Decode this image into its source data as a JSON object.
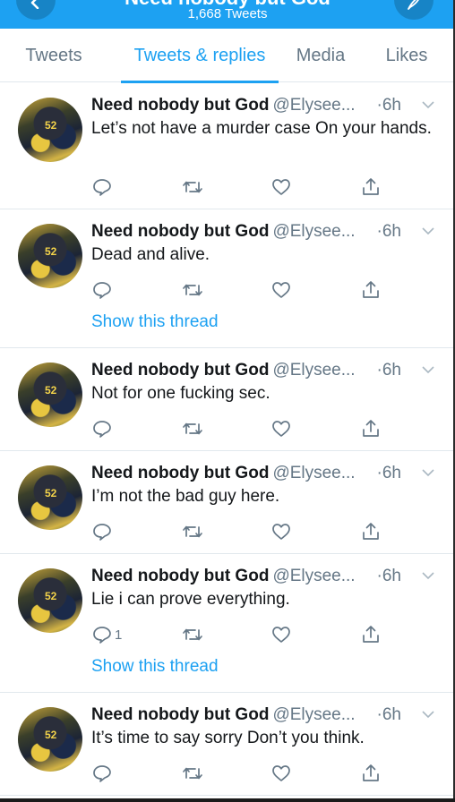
{
  "header": {
    "profile_name": "Need nobody but God",
    "tweet_count": "1,668 Tweets",
    "back_icon": "chevron-left-icon",
    "compose_icon": "feather-icon",
    "color": "#1da1f2"
  },
  "tabs": [
    {
      "label": "Tweets",
      "active": false
    },
    {
      "label": "Tweets & replies",
      "active": true
    },
    {
      "label": "Media",
      "active": false
    },
    {
      "label": "Likes",
      "active": false
    }
  ],
  "tweets": [
    {
      "name": "Need nobody but God",
      "handle": "@Elysee...",
      "time": "·6h",
      "text": "Let’s not have a murder case On your hands.",
      "reply_count": "",
      "thread_link": ""
    },
    {
      "name": "Need nobody but God",
      "handle": "@Elysee...",
      "time": "·6h",
      "text": "Dead and alive.",
      "reply_count": "",
      "thread_link": "Show this thread"
    },
    {
      "name": "Need nobody but God",
      "handle": "@Elysee...",
      "time": "·6h",
      "text": "Not for one fucking sec.",
      "reply_count": "",
      "thread_link": ""
    },
    {
      "name": "Need nobody but God",
      "handle": "@Elysee...",
      "time": "·6h",
      "text": "I’m not the bad guy here.",
      "reply_count": "",
      "thread_link": ""
    },
    {
      "name": "Need nobody but God",
      "handle": "@Elysee...",
      "time": "·6h",
      "text": "Lie i can prove everything.",
      "reply_count": "1",
      "thread_link": "Show this thread"
    },
    {
      "name": "Need nobody but God",
      "handle": "@Elysee...",
      "time": "·6h",
      "text": "It’s time to say sorry Don’t you think.",
      "reply_count": "",
      "thread_link": ""
    }
  ],
  "avatar_jersey_number": "52"
}
